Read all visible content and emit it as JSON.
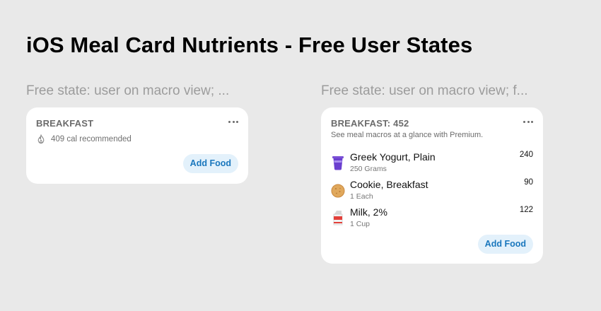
{
  "page": {
    "title": "iOS Meal Card Nutrients - Free User States"
  },
  "columns": [
    {
      "label": "Free state: user on macro view; ...",
      "card": {
        "meal_title": "BREAKFAST",
        "calorie_recommendation": "409 cal recommended",
        "add_food_label": "Add Food"
      }
    },
    {
      "label": "Free state: user on macro view; f...",
      "card": {
        "meal_title": "BREAKFAST: 452",
        "premium_note": "See meal macros at a glance with Premium.",
        "foods": [
          {
            "name": "Greek Yogurt, Plain",
            "serving": "250 Grams",
            "calories": "240",
            "icon": "yogurt-cup-icon"
          },
          {
            "name": "Cookie, Breakfast",
            "serving": "1 Each",
            "calories": "90",
            "icon": "cookie-icon"
          },
          {
            "name": "Milk, 2%",
            "serving": "1 Cup",
            "calories": "122",
            "icon": "milk-carton-icon"
          }
        ],
        "add_food_label": "Add Food"
      }
    }
  ],
  "colors": {
    "background": "#e9e9e9",
    "card": "#ffffff",
    "accent": "#1a77bd",
    "accent_bg": "#e3f1fb",
    "muted_text": "#6b6b6b"
  }
}
